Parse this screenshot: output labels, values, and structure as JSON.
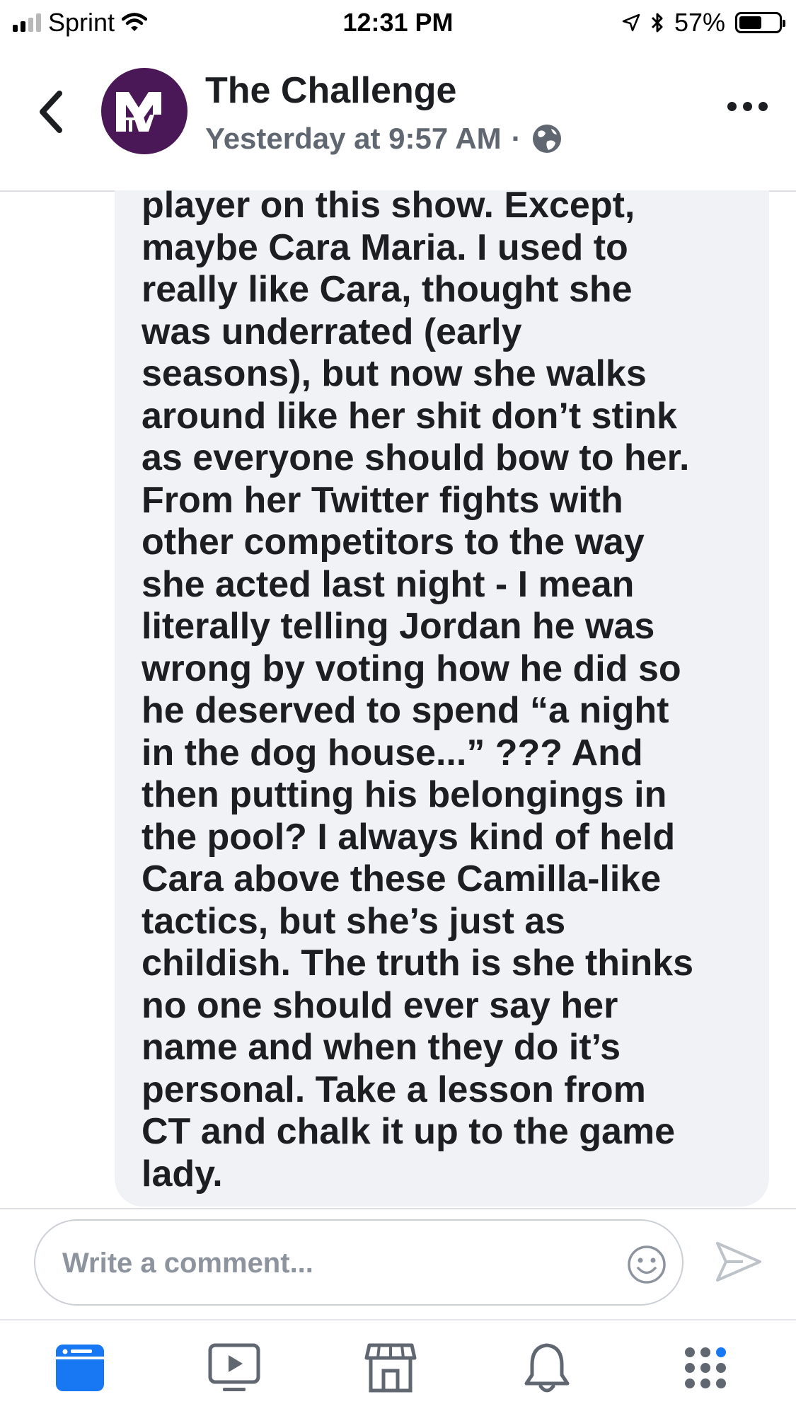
{
  "status_bar": {
    "carrier": "Sprint",
    "time": "12:31 PM",
    "battery_percent": "57%",
    "battery_level": 0.57,
    "icons": [
      "signal-icon",
      "wifi-icon",
      "location-icon",
      "bluetooth-icon",
      "battery-icon"
    ]
  },
  "header": {
    "page_name": "The Challenge",
    "timestamp": "Yesterday at 9:57 AM",
    "separator": "·",
    "privacy_icon": "globe-icon",
    "avatar_logo": "MTV"
  },
  "comment": {
    "text": "player on this show. Except,\nmaybe Cara Maria. I used to\nreally like Cara, thought she\nwas underrated (early\nseasons), but now she walks\naround like her shit don’t stink\nas everyone should bow to her.\nFrom her Twitter fights with\nother competitors to the way\nshe acted last night - I mean\nliterally telling Jordan he was\nwrong by voting how he did so\nhe deserved to spend “a night\nin the dog house...” ??? And\nthen putting his belongings in\nthe pool? I always kind of held\nCara above these Camilla-like\ntactics, but she’s just as\nchildish. The truth is she thinks\nno one should ever say her\nname and when they do it’s\npersonal. Take a lesson from\nCT and chalk it up to the game\nlady."
  },
  "composer": {
    "placeholder": "Write a comment...",
    "value": ""
  },
  "tab_bar": {
    "tabs": [
      {
        "icon": "news-feed-icon",
        "active": true
      },
      {
        "icon": "watch-icon",
        "active": false
      },
      {
        "icon": "marketplace-icon",
        "active": false
      },
      {
        "icon": "notifications-icon",
        "active": false
      },
      {
        "icon": "menu-icon",
        "active": false
      }
    ]
  },
  "colors": {
    "accent": "#1877f2",
    "bubble": "#f0f2f5",
    "text": "#1c1e21",
    "secondary_text": "#606770",
    "mtv_purple": "#4a1757"
  }
}
